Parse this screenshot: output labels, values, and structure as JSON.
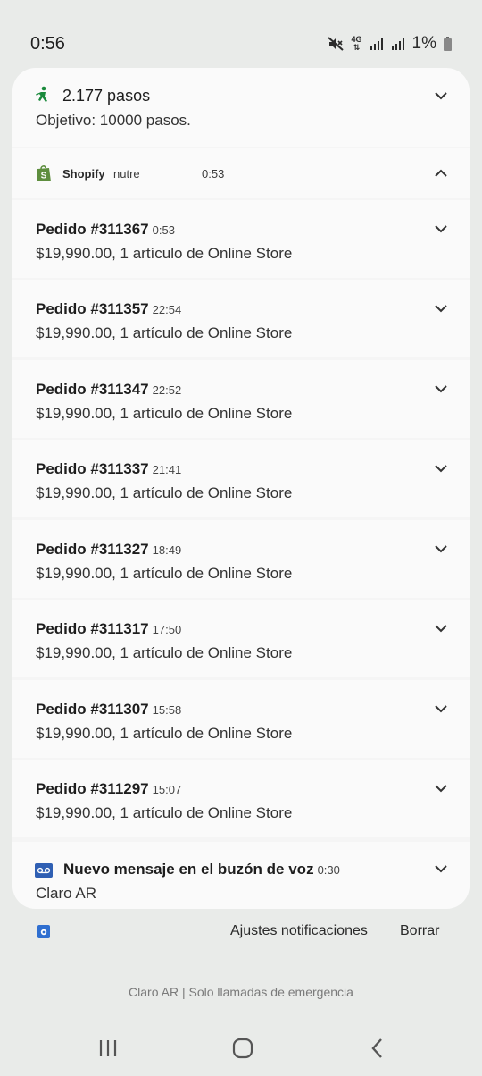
{
  "status_bar": {
    "time": "0:56",
    "network": "4G",
    "battery": "1%"
  },
  "steps": {
    "icon": "walking-person-icon",
    "title": "2.177 pasos",
    "subtitle": "Objetivo: 10000 pasos."
  },
  "shopify": {
    "icon": "shopify-bag-icon",
    "app_name": "Shopify",
    "subtext": "nutre",
    "time": "0:53",
    "orders": [
      {
        "title": "Pedido #311367",
        "time": "0:53",
        "desc": "$19,990.00, 1 artículo de Online Store"
      },
      {
        "title": "Pedido #311357",
        "time": "22:54",
        "desc": "$19,990.00, 1 artículo de Online Store"
      },
      {
        "title": "Pedido #311347",
        "time": "22:52",
        "desc": "$19,990.00, 1 artículo de Online Store"
      },
      {
        "title": "Pedido #311337",
        "time": "21:41",
        "desc": "$19,990.00, 1 artículo de Online Store"
      },
      {
        "title": "Pedido #311327",
        "time": "18:49",
        "desc": "$19,990.00, 1 artículo de Online Store"
      },
      {
        "title": "Pedido #311317",
        "time": "17:50",
        "desc": "$19,990.00, 1 artículo de Online Store"
      },
      {
        "title": "Pedido #311307",
        "time": "15:58",
        "desc": "$19,990.00, 1 artículo de Online Store"
      },
      {
        "title": "Pedido #311297",
        "time": "15:07",
        "desc": "$19,990.00, 1 artículo de Online Store"
      }
    ]
  },
  "voicemail": {
    "icon": "voicemail-icon",
    "title": "Nuevo mensaje en el buzón de voz",
    "time": "0:30",
    "subtitle": "Claro AR"
  },
  "actions": {
    "settings_label": "Ajustes notificaciones",
    "clear_label": "Borrar"
  },
  "carrier_text": "Claro AR | Solo llamadas de emergencia",
  "colors": {
    "background": "#e9ebe9",
    "panel": "#fafafa",
    "steps_green": "#1a8a3c",
    "shopify_green": "#5e8e3e",
    "voicemail_blue": "#2f5fb3"
  }
}
